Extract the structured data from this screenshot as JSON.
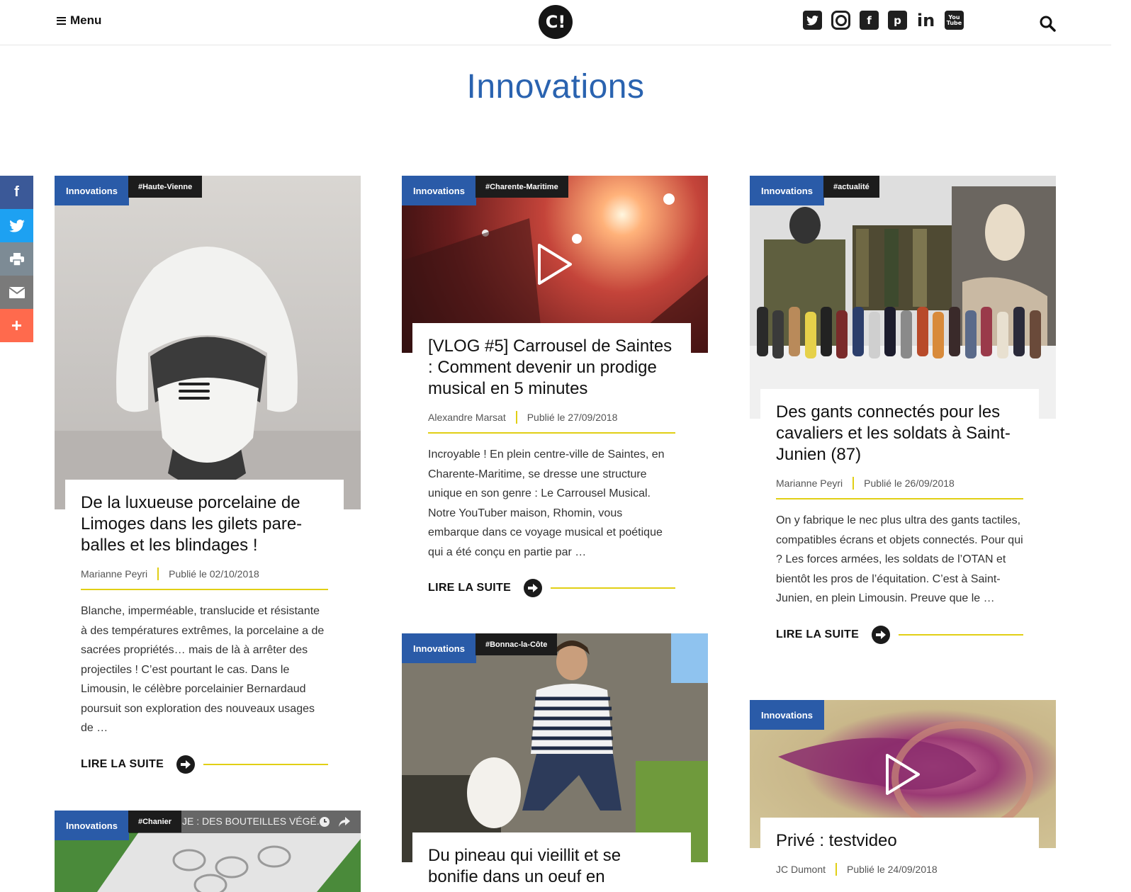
{
  "header": {
    "menu_label": "Menu",
    "logo_text": "C!",
    "socials": [
      "twitter-icon",
      "instagram-icon",
      "facebook-icon",
      "pinterest-icon",
      "linkedin-icon",
      "youtube-icon"
    ]
  },
  "page_title": "Innovations",
  "share": [
    "facebook-icon",
    "twitter-icon",
    "print-icon",
    "email-icon",
    "plus-icon"
  ],
  "cards": [
    {
      "category": "Innovations",
      "tag": "#Haute-Vienne",
      "title": "De la luxueuse porcelaine de Limoges dans les gilets pare-balles et les blindages !",
      "author": "Marianne Peyri",
      "date": "Publié le 02/10/2018",
      "excerpt": "Blanche, imperméable, translucide et résistante à des températures extrêmes, la porcelaine a de sacrées propriétés… mais de là à arrêter des projectiles ! C’est pourtant le cas. Dans le Limousin, le célèbre porcelainier Bernardaud poursuit son exploration des nouveaux usages de …",
      "more": "LIRE LA SUITE"
    },
    {
      "category": "Innovations",
      "tag": "#Charente-Maritime",
      "title": "[VLOG #5] Carrousel de Saintes : Comment devenir un prodige musical en 5 minutes",
      "author": "Alexandre Marsat",
      "date": "Publié le 27/09/2018",
      "excerpt": "Incroyable ! En plein centre-ville de Saintes, en Charente-Maritime, se dresse une structure unique en son genre : Le Carrousel Musical. Notre YouTuber maison, Rhomin, vous embarque dans ce voyage musical et poétique qui a été conçu en partie par …",
      "more": "LIRE LA SUITE"
    },
    {
      "category": "Innovations",
      "tag": "#actualité",
      "title": "Des gants connectés pour les cavaliers et les soldats à Saint-Junien (87)",
      "author": "Marianne Peyri",
      "date": "Publié le 26/09/2018",
      "excerpt": "On y fabrique le nec plus ultra des gants tactiles, compatibles écrans et objets connectés. Pour qui ? Les forces armées, les soldats de l’OTAN et bientôt les pros de l’équitation. C’est à Saint-Junien, en plein Limousin. Preuve que le …",
      "more": "LIRE LA SUITE"
    },
    {
      "category": "Innovations",
      "tag": "#Bonnac-la-Côte",
      "title": "Du pineau qui vieillit et se bonifie dans un oeuf en"
    },
    {
      "category": "Innovations",
      "title": "Privé : testvideo",
      "author": "JC Dumont",
      "date": "Publié le 24/09/2018"
    },
    {
      "category": "Innovations",
      "tag": "#Chanier",
      "video_caption": "JE : DES BOUTEILLES VÉGÉ..."
    }
  ]
}
